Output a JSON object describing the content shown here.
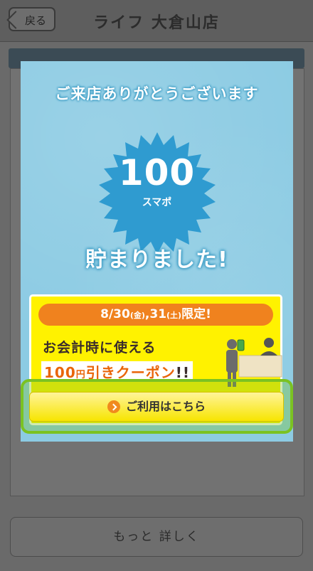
{
  "header": {
    "back_label": "戻る",
    "title": "ライフ 大倉山店"
  },
  "background": {
    "bottom_button_label": "もっと 詳しく"
  },
  "modal": {
    "welcome": "ご来店ありがとうございます",
    "points_value": "100",
    "points_unit": "スマポ",
    "earned_text": "貯まりました!",
    "coupon": {
      "date_part1": "8/30",
      "date_day1": "(金)",
      "date_sep": ",31",
      "date_day2": "(土)",
      "date_suffix": "限定!",
      "line1": "お会計時に使える",
      "amount": "100",
      "unit": "円",
      "rest": "引きクーポン",
      "excl": "!!"
    },
    "use_button_label": "ご利用はこちら"
  },
  "colors": {
    "modal_bg": "#8ccbe3",
    "badge": "#2f9bd0",
    "coupon_bg": "#fff200",
    "pill": "#f0821e",
    "highlight": "#7bc222"
  }
}
